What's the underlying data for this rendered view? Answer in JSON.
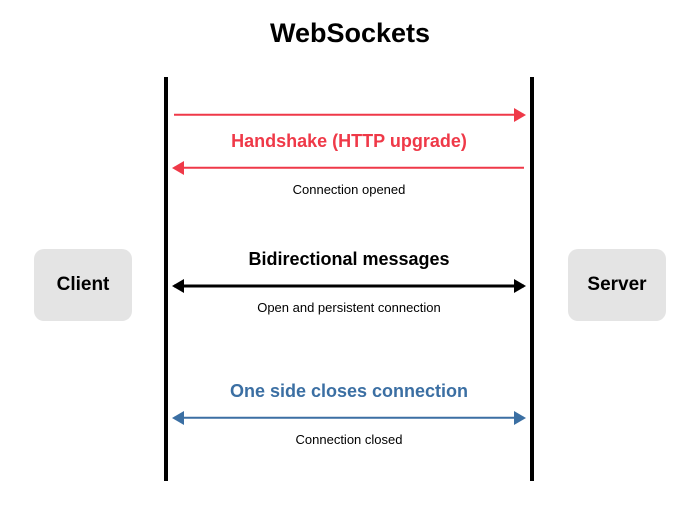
{
  "title": "WebSockets",
  "endpoints": {
    "client": "Client",
    "server": "Server"
  },
  "phases": {
    "handshake": {
      "label": "Handshake (HTTP upgrade)",
      "sub": "Connection opened",
      "color": "#ef3948"
    },
    "messages": {
      "label": "Bidirectional messages",
      "sub": "Open and persistent connection",
      "color": "#000000"
    },
    "close": {
      "label": "One side closes connection",
      "sub": "Connection closed",
      "color": "#3b6fa3"
    }
  }
}
